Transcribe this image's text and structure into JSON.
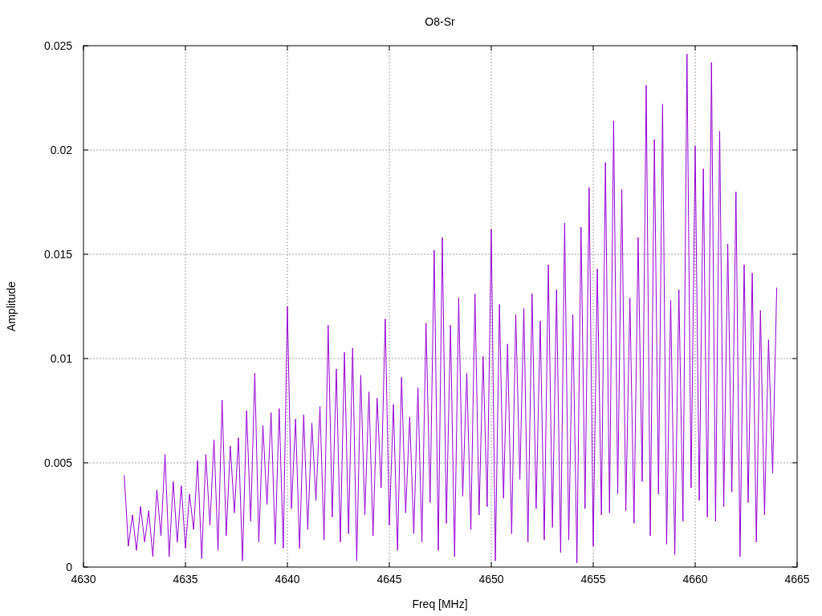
{
  "chart_data": {
    "type": "line",
    "grid": true,
    "title": "O8-Sr",
    "xlabel": "Freq [MHz]",
    "ylabel": "Amplitude",
    "xlim": [
      4630,
      4665
    ],
    "ylim": [
      0,
      0.025
    ],
    "xticks": [
      4630,
      4635,
      4640,
      4645,
      4650,
      4655,
      4660,
      4665
    ],
    "yticks": [
      {
        "value": 0,
        "label": "0"
      },
      {
        "value": 0.005,
        "label": "0.005"
      },
      {
        "value": 0.01,
        "label": "0.01"
      },
      {
        "value": 0.015,
        "label": "0.015"
      },
      {
        "value": 0.02,
        "label": "0.02"
      },
      {
        "value": 0.025,
        "label": "0.025"
      }
    ],
    "x": [
      4632,
      4632.2,
      4632.4,
      4632.6,
      4632.8,
      4633,
      4633.2,
      4633.4,
      4633.6,
      4633.8,
      4634,
      4634.2,
      4634.4,
      4634.6,
      4634.8,
      4635,
      4635.2,
      4635.4,
      4635.6,
      4635.8,
      4636,
      4636.2,
      4636.4,
      4636.6,
      4636.8,
      4637,
      4637.2,
      4637.4,
      4637.6,
      4637.8,
      4638,
      4638.2,
      4638.4,
      4638.6,
      4638.8,
      4639,
      4639.2,
      4639.4,
      4639.6,
      4639.8,
      4640,
      4640.2,
      4640.4,
      4640.6,
      4640.8,
      4641,
      4641.2,
      4641.4,
      4641.6,
      4641.8,
      4642,
      4642.2,
      4642.4,
      4642.6,
      4642.8,
      4643,
      4643.2,
      4643.4,
      4643.6,
      4643.8,
      4644,
      4644.2,
      4644.4,
      4644.6,
      4644.8,
      4645,
      4645.2,
      4645.4,
      4645.6,
      4645.8,
      4646,
      4646.2,
      4646.4,
      4646.6,
      4646.8,
      4647,
      4647.2,
      4647.4,
      4647.6,
      4647.8,
      4648,
      4648.2,
      4648.4,
      4648.6,
      4648.8,
      4649,
      4649.2,
      4649.4,
      4649.6,
      4649.8,
      4650,
      4650.2,
      4650.4,
      4650.6,
      4650.8,
      4651,
      4651.2,
      4651.4,
      4651.6,
      4651.8,
      4652,
      4652.2,
      4652.4,
      4652.6,
      4652.8,
      4653,
      4653.2,
      4653.4,
      4653.6,
      4653.8,
      4654,
      4654.2,
      4654.4,
      4654.6,
      4654.8,
      4655,
      4655.2,
      4655.4,
      4655.6,
      4655.8,
      4656,
      4656.2,
      4656.4,
      4656.6,
      4656.8,
      4657,
      4657.2,
      4657.4,
      4657.6,
      4657.8,
      4658,
      4658.2,
      4658.4,
      4658.6,
      4658.8,
      4659,
      4659.2,
      4659.4,
      4659.6,
      4659.8,
      4660,
      4660.2,
      4660.4,
      4660.6,
      4660.8,
      4661,
      4661.2,
      4661.4,
      4661.6,
      4661.8,
      4662,
      4662.2,
      4662.4,
      4662.6,
      4662.8,
      4663,
      4663.2,
      4663.4,
      4663.6,
      4663.8,
      4664
    ],
    "series": [
      {
        "color": "#9400d3",
        "values": [
          0.0044,
          0.001,
          0.0025,
          0.0008,
          0.0029,
          0.0012,
          0.0027,
          0.0005,
          0.0037,
          0.0015,
          0.0054,
          0.0005,
          0.0041,
          0.0012,
          0.0039,
          0.0009,
          0.0035,
          0.0018,
          0.0051,
          0.0004,
          0.0054,
          0.002,
          0.0061,
          0.0008,
          0.008,
          0.0015,
          0.0058,
          0.0026,
          0.0062,
          0.0003,
          0.0075,
          0.0022,
          0.0093,
          0.0012,
          0.0068,
          0.003,
          0.0074,
          0.0011,
          0.0076,
          0.0009,
          0.0125,
          0.0028,
          0.0071,
          0.0009,
          0.0073,
          0.0018,
          0.0069,
          0.0032,
          0.0077,
          0.0013,
          0.0116,
          0.0024,
          0.0095,
          0.0012,
          0.0103,
          0.0016,
          0.0105,
          0.0003,
          0.0092,
          0.0025,
          0.0084,
          0.0015,
          0.0081,
          0.0038,
          0.0119,
          0.002,
          0.0078,
          0.0008,
          0.0091,
          0.0026,
          0.0072,
          0.0016,
          0.0086,
          0.0012,
          0.0117,
          0.0031,
          0.0152,
          0.0008,
          0.0158,
          0.0021,
          0.0116,
          0.0005,
          0.0129,
          0.0034,
          0.0093,
          0.0018,
          0.0131,
          0.0025,
          0.0101,
          0.0029,
          0.0162,
          0.0003,
          0.0126,
          0.0033,
          0.0107,
          0.0016,
          0.0121,
          0.0042,
          0.0124,
          0.0012,
          0.0131,
          0.0028,
          0.0118,
          0.0013,
          0.0145,
          0.0019,
          0.0133,
          0.0007,
          0.0165,
          0.0013,
          0.0121,
          0.0002,
          0.0163,
          0.0028,
          0.0182,
          0.001,
          0.0143,
          0.0025,
          0.0194,
          0.0026,
          0.0214,
          0.0035,
          0.0181,
          0.0027,
          0.0129,
          0.0021,
          0.0158,
          0.0041,
          0.0231,
          0.0015,
          0.0205,
          0.0035,
          0.0222,
          0.0011,
          0.0128,
          0.0006,
          0.0133,
          0.0022,
          0.0246,
          0.0038,
          0.0202,
          0.0032,
          0.0191,
          0.0024,
          0.0242,
          0.0022,
          0.0209,
          0.0029,
          0.0155,
          0.0036,
          0.018,
          0.0005,
          0.0145,
          0.0031,
          0.0141,
          0.0012,
          0.0123,
          0.0025,
          0.0109,
          0.0045,
          0.0134
        ]
      }
    ]
  }
}
